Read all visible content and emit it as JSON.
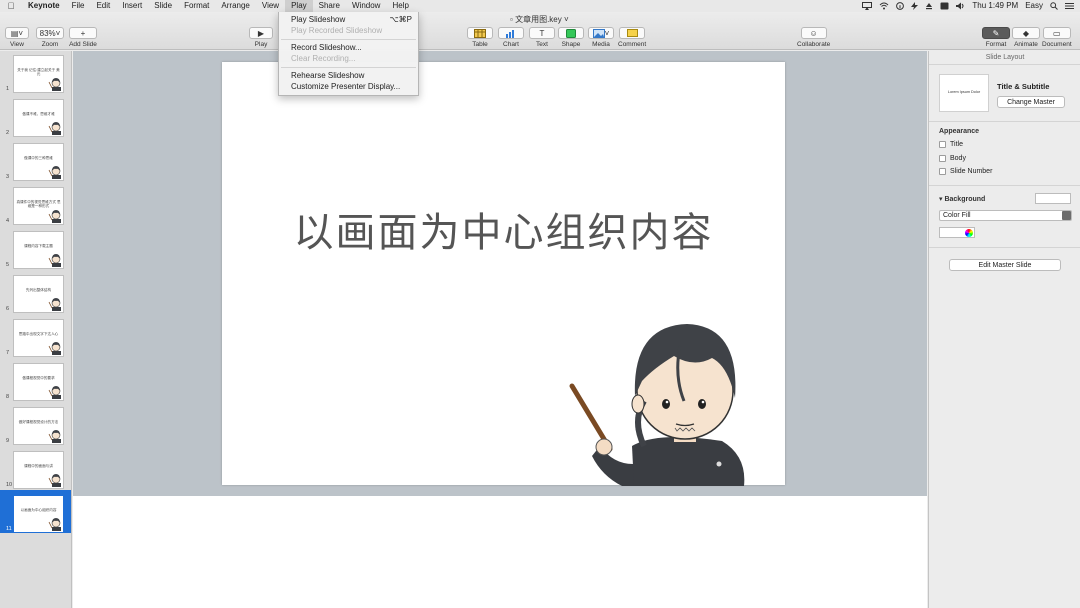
{
  "menubar": {
    "apple_icon": "apple-icon",
    "items": [
      "Keynote",
      "File",
      "Edit",
      "Insert",
      "Slide",
      "Format",
      "Arrange",
      "View",
      "Play",
      "Share",
      "Window",
      "Help"
    ],
    "active": "Play",
    "status": {
      "clock": "Thu 1:49 PM",
      "user": "Easy"
    }
  },
  "toolbar": {
    "doc_title": "文章用图.key",
    "view": "View",
    "zoom_value": "83%",
    "zoom": "Zoom",
    "add_slide": "Add Slide",
    "play": "Play",
    "table": "Table",
    "chart": "Chart",
    "text": "Text",
    "shape": "Shape",
    "media": "Media",
    "comment": "Comment",
    "collaborate": "Collaborate",
    "format": "Format",
    "animate": "Animate",
    "document": "Document"
  },
  "play_menu": {
    "play_slideshow": "Play Slideshow",
    "play_slideshow_shortcut": "⌥⌘P",
    "play_recorded": "Play Recorded Slideshow",
    "record": "Record Slideshow...",
    "clear_recording": "Clear Recording...",
    "rehearse": "Rehearse Slideshow",
    "customize_presenter": "Customize Presenter Display..."
  },
  "navigator": {
    "slides": [
      {
        "num": "1",
        "text": "关于我 记住:建立起关于 美元"
      },
      {
        "num": "2",
        "text": "做课不难，思维才难"
      },
      {
        "num": "3",
        "text": "做课中的三种思维"
      },
      {
        "num": "4",
        "text": "真课件中的视觉思维方式 思维是一种形式"
      },
      {
        "num": "5",
        "text": "课程内容下载主题"
      },
      {
        "num": "6",
        "text": "先列出整体结构"
      },
      {
        "num": "7",
        "text": "思路中出现文字下达人心"
      },
      {
        "num": "8",
        "text": "做课程视觉中的要求"
      },
      {
        "num": "9",
        "text": "做好课程视觉设计的方法"
      },
      {
        "num": "10",
        "text": "课程中的面面与讲"
      },
      {
        "num": "11",
        "text": "以画面为中心组织内容"
      }
    ],
    "selected_index": 10
  },
  "slide": {
    "title": "以画面为中心组织内容"
  },
  "inspector": {
    "header": "Slide Layout",
    "master_thumb_text": "Lorem Ipsum Dolor",
    "master_name": "Title & Subtitle",
    "change_master": "Change Master",
    "appearance_label": "Appearance",
    "title_cb": "Title",
    "body_cb": "Body",
    "slide_number_cb": "Slide Number",
    "background_label": "Background",
    "fill_type": "Color Fill",
    "edit_master": "Edit Master Slide"
  }
}
